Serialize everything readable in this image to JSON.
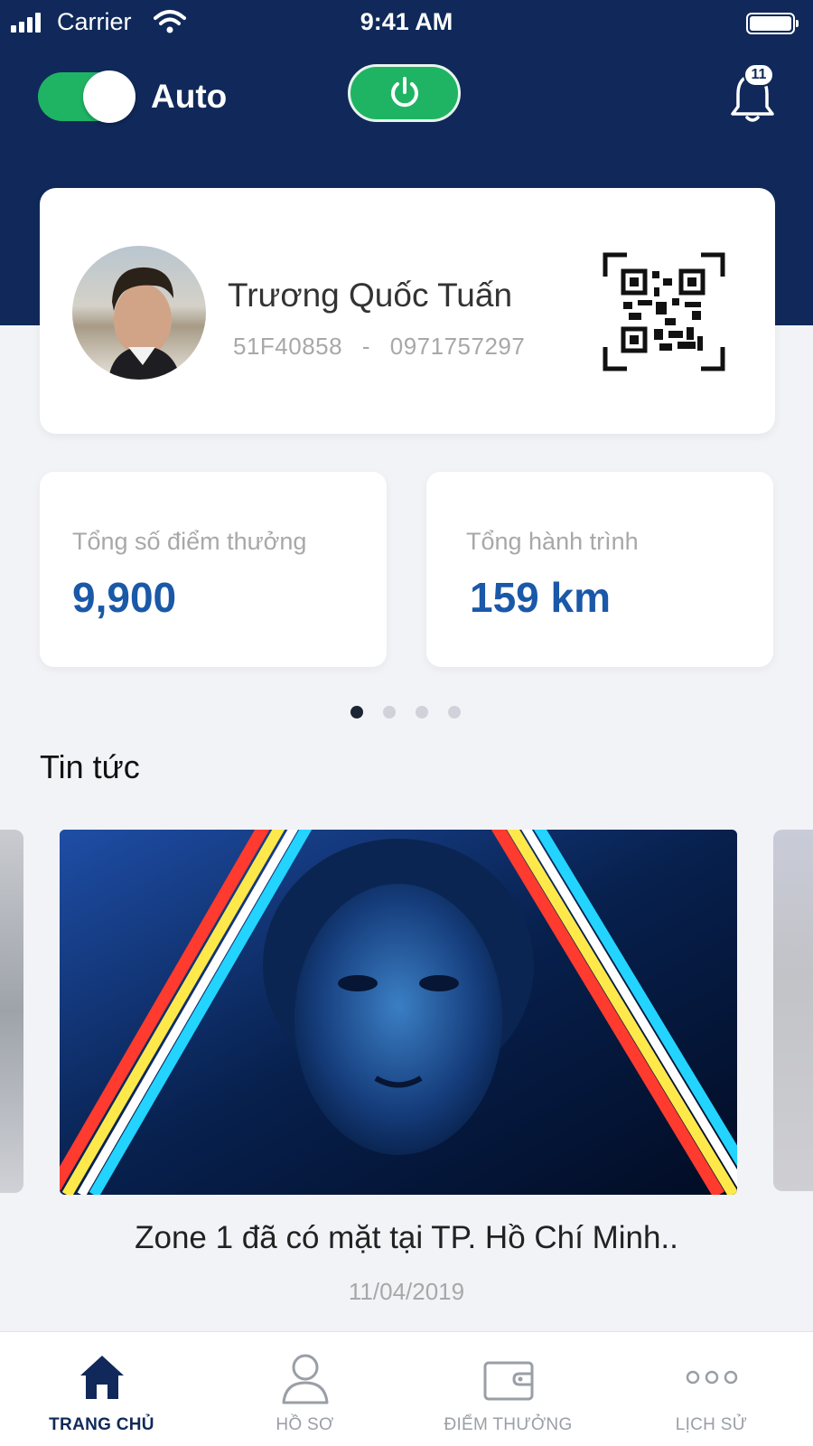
{
  "status_bar": {
    "carrier": "Carrier",
    "time": "9:41 AM"
  },
  "header": {
    "mode_label": "Auto",
    "auto_enabled": true,
    "notification_count": "11",
    "accent_color": "#1fb464",
    "background_color": "#10295a"
  },
  "profile": {
    "name": "Trương Quốc Tuấn",
    "plate": "51F40858",
    "separator": "-",
    "phone": "0971757297"
  },
  "stats": [
    {
      "label": "Tổng số điểm thưởng",
      "value": "9,900"
    },
    {
      "label": "Tổng hành trình",
      "value": "159 km"
    }
  ],
  "pager": {
    "count": 4,
    "active_index": 0
  },
  "news": {
    "section_title": "Tin tức",
    "item": {
      "title": "Zone 1 đã có mặt tại TP. Hồ Chí Minh..",
      "date": "11/04/2019"
    }
  },
  "tabs": [
    {
      "label": "TRANG CHỦ",
      "icon": "home-icon",
      "active": true
    },
    {
      "label": "HỒ SƠ",
      "icon": "user-icon",
      "active": false
    },
    {
      "label": "ĐIỂM THƯỞNG",
      "icon": "wallet-icon",
      "active": false
    },
    {
      "label": "LỊCH SỬ",
      "icon": "more-icon",
      "active": false
    }
  ]
}
